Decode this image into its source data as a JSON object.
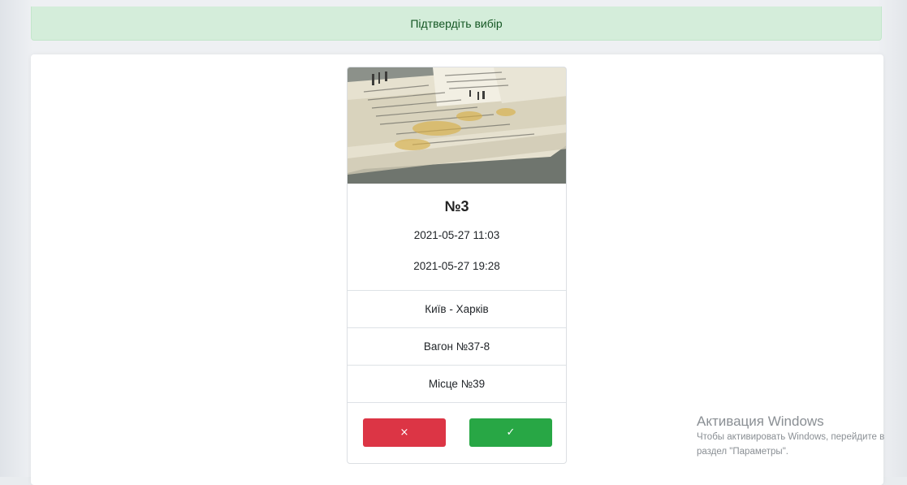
{
  "alert": {
    "text": "Підтвердіть вибір",
    "color": "#155724",
    "background": "#d4edda"
  },
  "ticket": {
    "image_icon": "train-ticket-photo",
    "title": "№3",
    "departure": "2021-05-27 11:03",
    "arrival": "2021-05-27 19:28",
    "route": "Київ - Харків",
    "wagon": "Вагон №37-8",
    "seat": "Місце №39"
  },
  "actions": {
    "cancel_label": "×",
    "cancel_color": "#dc3545",
    "confirm_label": "✓",
    "confirm_color": "#28a745"
  },
  "watermark": {
    "title": "Активация Windows",
    "line1": "Чтобы активировать Windows, перейдите в",
    "line2": "раздел \"Параметры\"."
  }
}
